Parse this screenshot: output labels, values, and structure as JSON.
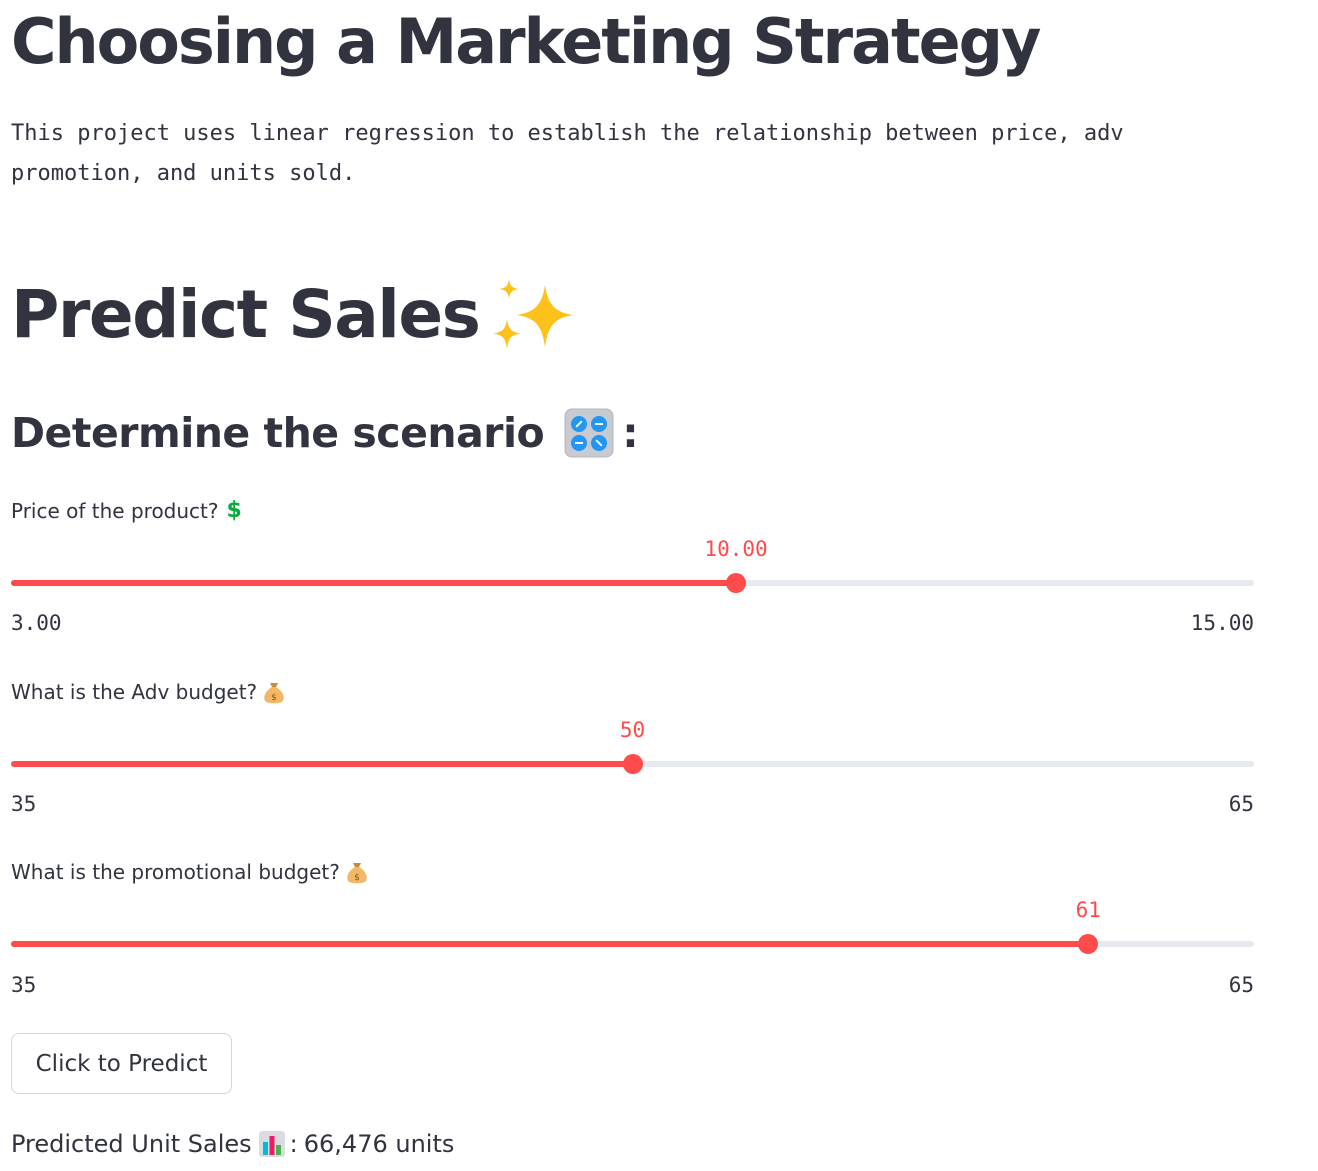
{
  "header": {
    "title": "Choosing a Marketing Strategy",
    "intro_line1": "This project uses linear regression to establish the relationship between price, adv",
    "intro_line2": "promotion, and units sold."
  },
  "predict_section": {
    "title": "Predict Sales",
    "title_icon": "sparkles-icon",
    "subtitle": "Determine the scenario",
    "subtitle_icon": "control-knobs-icon",
    "subtitle_suffix": ":"
  },
  "sliders": [
    {
      "label": "Price of the product?",
      "icon": "dollar-icon",
      "icon_text": "$",
      "value": "10.00",
      "min": "3.00",
      "max": "15.00",
      "fraction": 0.5833
    },
    {
      "label": "What is the Adv budget?",
      "icon": "money-bag-icon",
      "value": "50",
      "min": "35",
      "max": "65",
      "fraction": 0.5
    },
    {
      "label": "What is the promotional budget?",
      "icon": "money-bag-icon",
      "value": "61",
      "min": "35",
      "max": "65",
      "fraction": 0.8667
    }
  ],
  "button": {
    "label": "Click to Predict"
  },
  "result": {
    "label": "Predicted Unit Sales",
    "icon": "bar-chart-icon",
    "separator": ":",
    "value": "66,476 units"
  },
  "colors": {
    "accent": "#ff4b4b",
    "track": "#e6e9ef",
    "text": "#31333f",
    "dollar": "#09ab3b"
  }
}
